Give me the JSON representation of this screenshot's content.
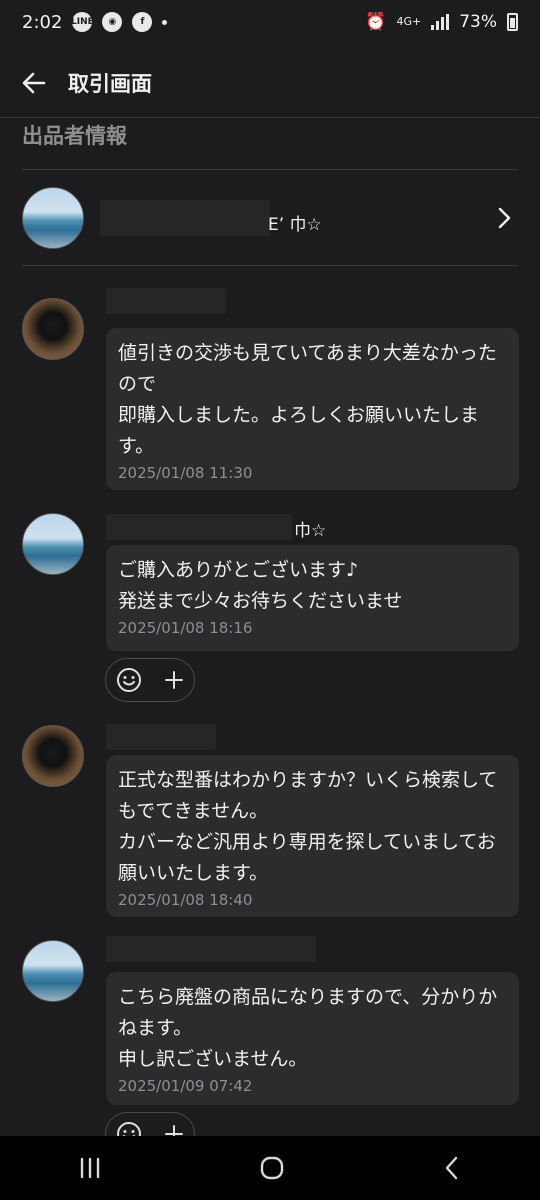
{
  "status_bar": {
    "time": "2:02",
    "network": "4G+",
    "battery": "73%"
  },
  "header": {
    "title": "取引画面"
  },
  "seller_section": {
    "title": "出品者情報",
    "seller_name": "E’ 巾☆"
  },
  "messages": [
    {
      "sender_name": "",
      "text": "値引きの交渉も見ていてあまり大差なかったので\n即購入しました。よろしくお願いいたします。",
      "timestamp": "2025/01/08 11:30"
    },
    {
      "sender_name": "巾☆",
      "text": "ご購入ありがとございます♪\n発送まで少々お待ちくださいませ",
      "timestamp": "2025/01/08 18:16"
    },
    {
      "sender_name": "",
      "text": "正式な型番はわかりますか？いくら検索してもでてきません。\nカバーなど汎用より専用を探していましてお願いいたします。",
      "timestamp": "2025/01/08 18:40"
    },
    {
      "sender_name": "",
      "text": "こちら廃盤の商品になりますので、分かりかねます。\n申し訳ございません。",
      "timestamp": "2025/01/09 07:42"
    }
  ],
  "icons": [
    "back-arrow-icon",
    "chevron-right-icon",
    "emoji-icon",
    "plus-icon",
    "recents-icon",
    "home-icon",
    "back-nav-icon"
  ]
}
